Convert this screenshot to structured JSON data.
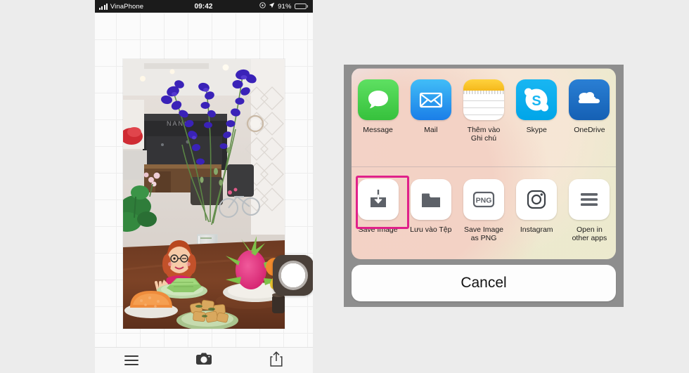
{
  "phone": {
    "statusbar": {
      "carrier": "VinaPhone",
      "time": "09:42",
      "battery_percent": "91%",
      "signal_icon": "signal-bars-icon",
      "location_icon": "location-arrow-icon",
      "lock_rotation_icon": "rotation-lock-icon",
      "battery_icon": "battery-low-power-icon"
    },
    "photo": {
      "alt": "Blue delphinium flowers in a glass vase on a wooden table with Vietnamese food, green sticky rice cake, orange sticky rice, fried rolls and a plate of fruit with dragon fruit; cartoon avatar sticker of a girl with glasses making a peace sign",
      "sticker_name": "bitmoji-avatar-sticker"
    },
    "lens_button": "camera-lens-button",
    "toolbar": {
      "menu_icon": "hamburger-menu-icon",
      "camera_icon": "camera-icon",
      "share_icon": "share-upload-icon"
    }
  },
  "share_sheet": {
    "app_row": [
      {
        "label": "Message",
        "icon": "messages-app-icon",
        "color": "#36c13c"
      },
      {
        "label": "Mail",
        "icon": "mail-app-icon",
        "color": "#1a7ee8"
      },
      {
        "label": "Thêm vào\nGhi chú",
        "icon": "notes-app-icon",
        "color": "#ffd23d"
      },
      {
        "label": "Skype",
        "icon": "skype-app-icon",
        "color": "#00aff0"
      },
      {
        "label": "OneDrive",
        "icon": "onedrive-app-icon",
        "color": "#1560b4"
      }
    ],
    "action_row": [
      {
        "label": "Save Image",
        "icon": "save-image-icon",
        "highlighted": true
      },
      {
        "label": "Lưu vào Tệp",
        "icon": "save-to-files-icon",
        "highlighted": false
      },
      {
        "label": "Save Image\nas PNG",
        "icon": "png-icon",
        "highlighted": false
      },
      {
        "label": "Instagram",
        "icon": "instagram-icon",
        "highlighted": false
      },
      {
        "label": "Open in\nother apps",
        "icon": "open-in-other-apps-icon",
        "highlighted": false
      }
    ],
    "cancel_label": "Cancel",
    "highlight_color": "#e0218a"
  }
}
